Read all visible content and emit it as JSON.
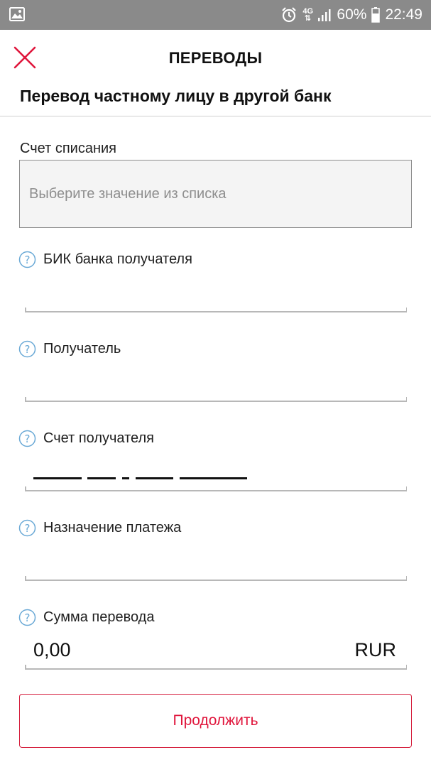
{
  "status_bar": {
    "network": "4G",
    "battery": "60%",
    "time": "22:49",
    "icons": [
      "gallery-icon",
      "alarm-icon",
      "signal-icon",
      "battery-icon"
    ]
  },
  "header": {
    "title": "ПЕРЕВОДЫ",
    "close_icon": "close-icon"
  },
  "section": {
    "title": "Перевод частному лицу в другой банк"
  },
  "form": {
    "debit_account": {
      "label": "Счет списания",
      "placeholder": "Выберите значение из списка"
    },
    "bik": {
      "label": "БИК банка получателя",
      "value": ""
    },
    "recipient": {
      "label": "Получатель",
      "value": ""
    },
    "recipient_account": {
      "label": "Счет получателя",
      "mask": "_____ ___ _ ____ _______"
    },
    "purpose": {
      "label": "Назначение платежа",
      "value": ""
    },
    "amount": {
      "label": "Сумма перевода",
      "value": "0,00",
      "currency": "RUR"
    }
  },
  "actions": {
    "continue_label": "Продолжить"
  },
  "colors": {
    "accent": "#e0163c",
    "help_icon": "#6aa9d6",
    "status_bar": "#8a8a8a"
  }
}
